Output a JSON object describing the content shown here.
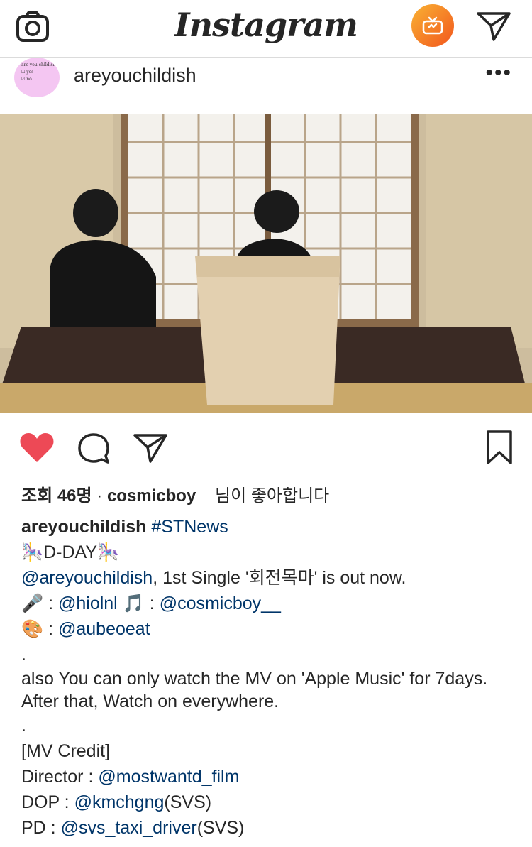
{
  "app": {
    "logo_text": "Instagram"
  },
  "topbar": {
    "camera_icon": "camera-icon",
    "igtv_icon": "igtv-icon",
    "direct_icon": "direct-message-icon",
    "igtv_gradient": [
      "#f9b233",
      "#f2561d"
    ]
  },
  "post": {
    "username": "areyouchildish",
    "avatar_text_line1": "are you childish?",
    "avatar_text_line2": "yes",
    "avatar_text_line3": "no",
    "more_label": "•••",
    "avatar_color": "#f4c6f2"
  },
  "stats": {
    "views": "조회 46명",
    "separator": " · ",
    "liked_by_user": "cosmicboy__",
    "liked_by_suffix": "님이 좋아합니다"
  },
  "caption": {
    "author": "areyouchildish",
    "hashtag": "#STNews",
    "line2": "🎠D-DAY🎠",
    "line3_mention": "@areyouchildish",
    "line3_text": ", 1st Single '회전목마' is out now.",
    "line4_emoji1": "🎤",
    "line4_sep1": " : ",
    "line4_mention1": "@hiolnl",
    "line4_emoji2": " 🎵 ",
    "line4_sep2": " : ",
    "line4_mention2": "@cosmicboy__",
    "line5_emoji": "🎨",
    "line5_sep": " : ",
    "line5_mention": "@aubeoeat",
    "dot1": ".",
    "paragraph": "also You can only watch the MV on 'Apple Music' for 7days. After that, Watch on everywhere.",
    "dot2": ".",
    "credit_header": "[MV Credit]",
    "director_label": "Director : ",
    "director_mention": "@mostwantd_film",
    "dop_label": "DOP : ",
    "dop_mention": "@kmchgng",
    "dop_suffix": "(SVS)",
    "pd_label": "PD : ",
    "pd_mention": "@svs_taxi_driver",
    "pd_suffix": "(SVS)"
  },
  "colors": {
    "like_red": "#ed4956",
    "link_blue": "#003569"
  }
}
